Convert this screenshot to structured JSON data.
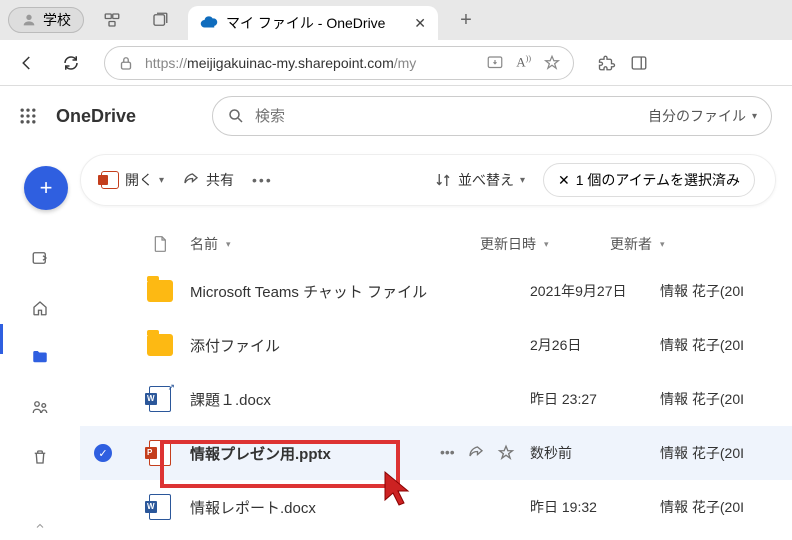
{
  "browser": {
    "profile_label": "学校",
    "tab_title": "マイ ファイル - OneDrive",
    "url_display": "https://meijigakuinac-my.sharepoint.com/my",
    "url_scheme": "https://",
    "url_host": "meijigakuinac-my.sharepoint.com",
    "url_path": "/my"
  },
  "app": {
    "brand": "OneDrive",
    "search_placeholder": "検索",
    "search_filter_label": "自分のファイル"
  },
  "toolbar": {
    "open_label": "開く",
    "share_label": "共有",
    "sort_label": "並べ替え",
    "selection_label": "1 個のアイテムを選択済み"
  },
  "columns": {
    "name": "名前",
    "date": "更新日時",
    "modifier": "更新者"
  },
  "files": [
    {
      "type": "folder",
      "name": "Microsoft Teams チャット ファイル",
      "date": "2021年9月27日",
      "modifier": "情報 花子(20I",
      "selected": false
    },
    {
      "type": "folder",
      "name": "添付ファイル",
      "date": "2月26日",
      "modifier": "情報 花子(20I",
      "selected": false
    },
    {
      "type": "word",
      "name": "課題１.docx",
      "shortcut": true,
      "date": "昨日 23:27",
      "modifier": "情報 花子(20I",
      "selected": false
    },
    {
      "type": "ppt",
      "name": "情報プレゼン用.pptx",
      "date": "数秒前",
      "modifier": "情報 花子(20I",
      "selected": true
    },
    {
      "type": "word",
      "name": "情報レポート.docx",
      "date": "昨日 19:32",
      "modifier": "情報 花子(20I",
      "selected": false
    }
  ]
}
